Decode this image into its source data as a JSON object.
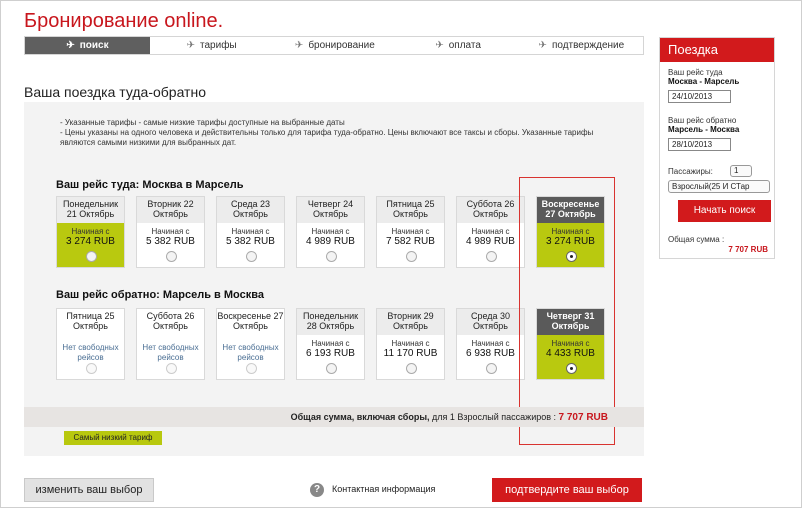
{
  "title": "Бронирование online.",
  "steps": [
    {
      "label": "поиск",
      "active": true
    },
    {
      "label": "тарифы"
    },
    {
      "label": "бронирование"
    },
    {
      "label": "оплата"
    },
    {
      "label": "подтверждение"
    }
  ],
  "heading": "Ваша поездка туда-обратно",
  "notes": [
    "- Указанные тарифы - самые низкие тарифы доступные на выбранные даты",
    "- Цены указаны на одного человека и действительны только для тарифа туда-обратно. Цены включают все таксы и сборы. Указанные тарифы являются самыми низкими для выбранных дат."
  ],
  "outbound": {
    "title": "Ваш рейс туда: Москва в Марсель",
    "cards": [
      {
        "date": "Понедельник 21 Октябрь",
        "from": "Начиная с",
        "price": "3 274 RUB",
        "style": "green"
      },
      {
        "date": "Вторник 22 Октябрь",
        "from": "Начиная с",
        "price": "5 382 RUB"
      },
      {
        "date": "Среда 23 Октябрь",
        "from": "Начиная с",
        "price": "5 382 RUB"
      },
      {
        "date": "Четверг 24 Октябрь",
        "from": "Начиная с",
        "price": "4 989 RUB"
      },
      {
        "date": "Пятница 25 Октябрь",
        "from": "Начиная с",
        "price": "7 582 RUB"
      },
      {
        "date": "Суббота 26 Октябрь",
        "from": "Начиная с",
        "price": "4 989 RUB"
      },
      {
        "date": "Воскресенье 27 Октябрь",
        "from": "Начиная с",
        "price": "3 274 RUB",
        "style": "selected"
      }
    ]
  },
  "inbound": {
    "title": "Ваш рейс обратно: Марсель в Москва",
    "cards": [
      {
        "date": "Пятница 25 Октябрь",
        "none": "Нет свободных рейсов"
      },
      {
        "date": "Суббота 26 Октябрь",
        "none": "Нет свободных рейсов"
      },
      {
        "date": "Воскресенье 27 Октябрь",
        "none": "Нет свободных рейсов"
      },
      {
        "date": "Понедельник 28 Октябрь",
        "from": "Начиная с",
        "price": "6 193 RUB"
      },
      {
        "date": "Вторник 29 Октябрь",
        "from": "Начиная с",
        "price": "11 170 RUB"
      },
      {
        "date": "Среда 30 Октябрь",
        "from": "Начиная с",
        "price": "6 938 RUB"
      },
      {
        "date": "Четверг 31 Октябрь",
        "from": "Начиная с",
        "price": "4 433 RUB",
        "style": "selected"
      }
    ]
  },
  "total": {
    "label": "Общая сумма, включая сборы,",
    "for": " для 1 Взрослый пассажиров :",
    "amount": "7 707 RUB"
  },
  "badge": "Самый низкий тариф",
  "footer": {
    "change": "изменить ваш выбор",
    "contact": "Контактная информация",
    "confirm": "подтвердите ваш выбор"
  },
  "sidebar": {
    "title": "Поездка",
    "outbound_label": "Ваш рейс туда",
    "outbound_route": "Москва - Марсель",
    "outbound_date": "24/10/2013",
    "return_label": "Ваш рейс обратно",
    "return_route": "Марсель - Москва",
    "return_date": "28/10/2013",
    "passengers_label": "Пассажиры:",
    "passengers_count": "1",
    "passenger_type": "Взрослый(25 И СТар",
    "search_button": "Начать поиск",
    "total_label": "Общая сумма :",
    "total_amount": "7 707 RUB"
  },
  "colors": {
    "accent": "#d21a1c",
    "green": "#b9c90f"
  }
}
